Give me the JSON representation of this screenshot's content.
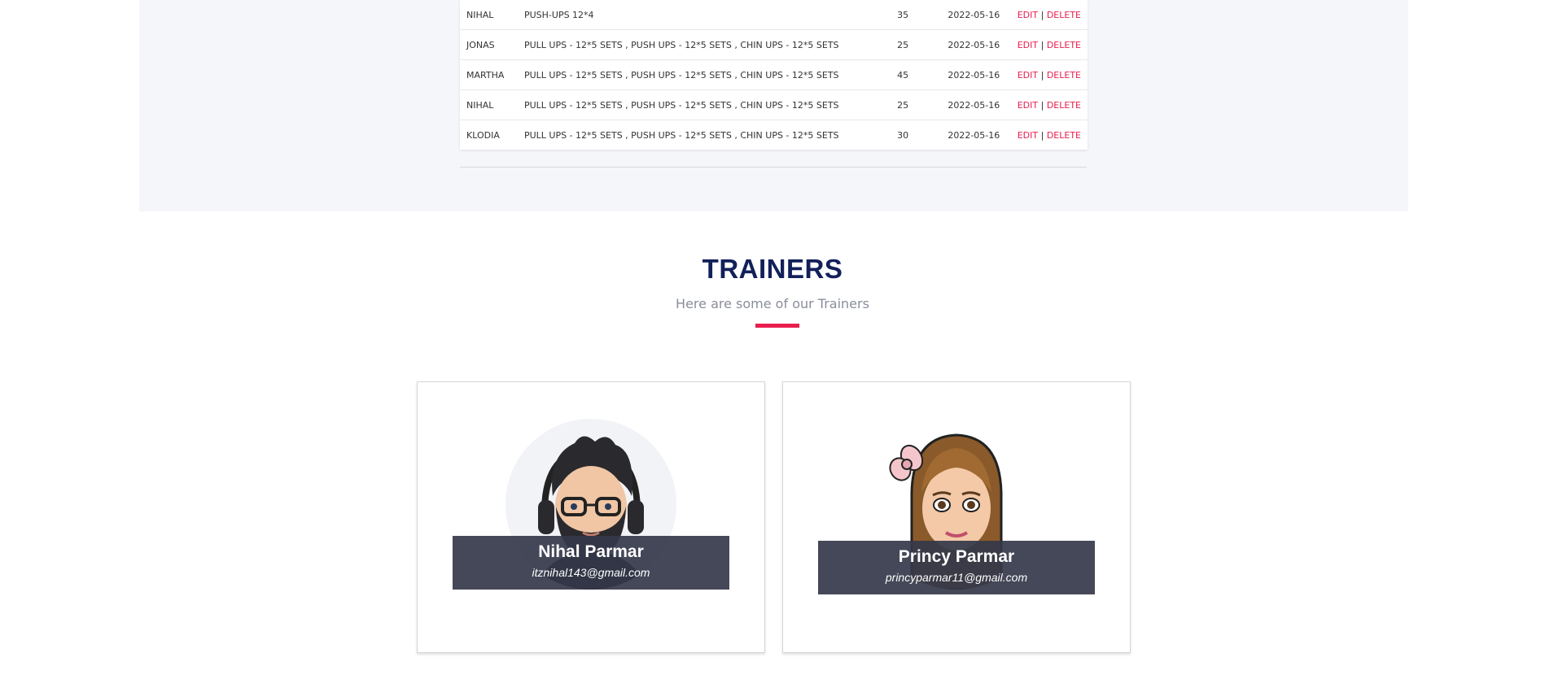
{
  "table": {
    "rows": [
      {
        "name": "NIHAL",
        "workout": "PUSH-UPS 12*4",
        "value": "35",
        "date": "2022-05-16",
        "edit": "EDIT",
        "sep": "|",
        "delete": "DELETE"
      },
      {
        "name": "JONAS",
        "workout": "PULL UPS - 12*5 SETS , PUSH UPS - 12*5 SETS , CHIN UPS - 12*5 SETS",
        "value": "25",
        "date": "2022-05-16",
        "edit": "EDIT",
        "sep": "|",
        "delete": "DELETE"
      },
      {
        "name": "MARTHA",
        "workout": "PULL UPS - 12*5 SETS , PUSH UPS - 12*5 SETS , CHIN UPS - 12*5 SETS",
        "value": "45",
        "date": "2022-05-16",
        "edit": "EDIT",
        "sep": "|",
        "delete": "DELETE"
      },
      {
        "name": "NIHAL",
        "workout": "PULL UPS - 12*5 SETS , PUSH UPS - 12*5 SETS , CHIN UPS - 12*5 SETS",
        "value": "25",
        "date": "2022-05-16",
        "edit": "EDIT",
        "sep": "|",
        "delete": "DELETE"
      },
      {
        "name": "KLODIA",
        "workout": "PULL UPS - 12*5 SETS , PUSH UPS - 12*5 SETS , CHIN UPS - 12*5 SETS",
        "value": "30",
        "date": "2022-05-16",
        "edit": "EDIT",
        "sep": "|",
        "delete": "DELETE"
      }
    ]
  },
  "trainers": {
    "title": "TRAINERS",
    "subtitle": "Here are some of our Trainers",
    "cards": [
      {
        "name": "Nihal Parmar",
        "email": "itznihal143@gmail.com",
        "avatar_icon": "male-bitmoji-avatar-icon"
      },
      {
        "name": "Princy Parmar",
        "email": "princyparmar11@gmail.com",
        "avatar_icon": "female-bitmoji-avatar-icon"
      }
    ]
  },
  "colors": {
    "accent": "#e91e4f",
    "title": "#12205a",
    "section_bg": "#f5f6fa",
    "overlay": "#34384a"
  }
}
